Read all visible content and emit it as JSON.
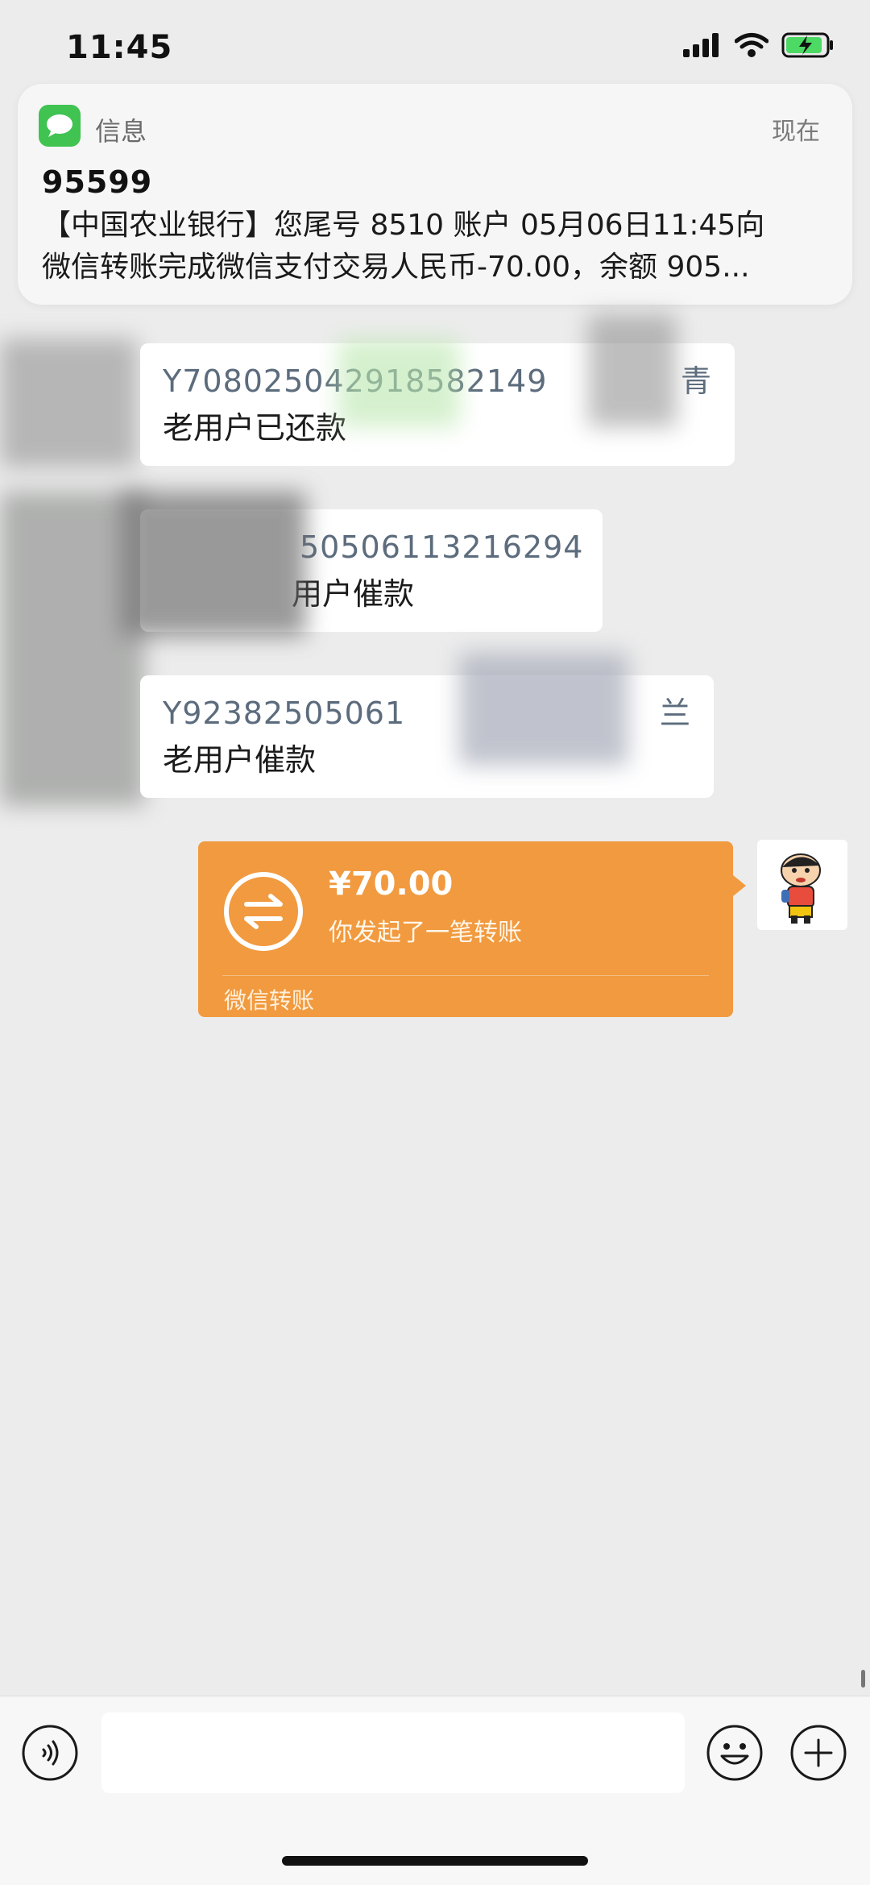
{
  "status_bar": {
    "time": "11:45"
  },
  "notification": {
    "app_name": "信息",
    "when": "现在",
    "sender": "95599",
    "body_line1": "【中国农业银行】您尾号 8510 账户 05月06日11:45向",
    "body_line2": "微信转账完成微信支付交易人民币-70.00，余额 905..."
  },
  "messages": [
    {
      "code": "Y708025042918582149",
      "tail": "青",
      "text": "老用户已还款"
    },
    {
      "code": "50506113216294",
      "text": "用户催款"
    },
    {
      "code": "Y92382505061",
      "tail": "兰",
      "text": "老用户催款"
    }
  ],
  "transfer": {
    "amount": "¥70.00",
    "description": "你发起了一笔转账",
    "brand": "微信转账"
  },
  "colors": {
    "transfer_orange": "#f19a3f",
    "chat_background": "#ececec"
  },
  "icons": [
    "voice-icon",
    "emoji-icon",
    "plus-icon",
    "transfer-icon"
  ]
}
